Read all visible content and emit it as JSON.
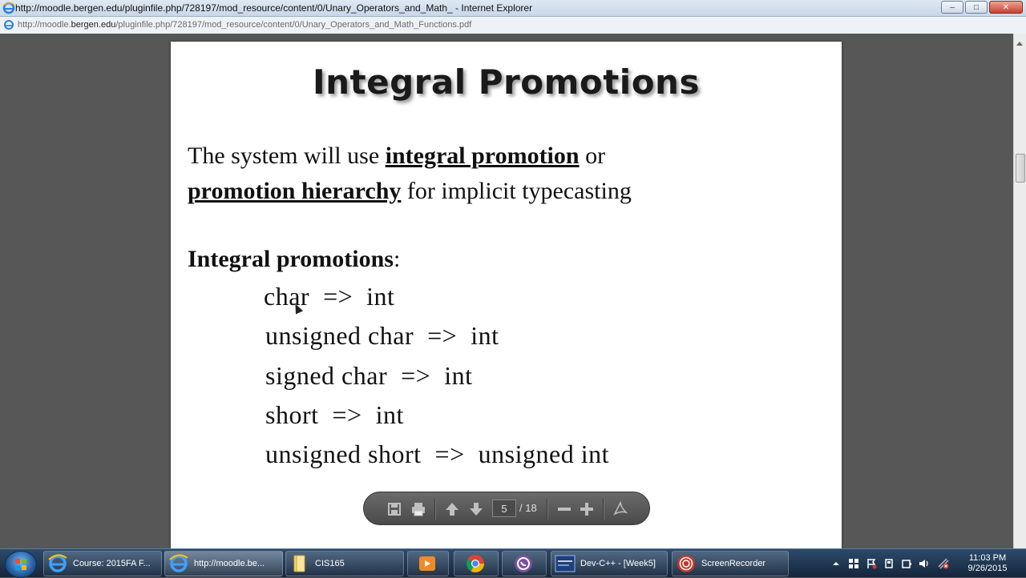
{
  "window": {
    "title": "http://moodle.bergen.edu/pluginfile.php/728197/mod_resource/content/0/Unary_Operators_and_Math_ - Internet Explorer",
    "controls": {
      "minimize": "–",
      "maximize": "□",
      "close": "✕"
    }
  },
  "address": {
    "url_prefix": "http://moodle.",
    "url_domain": "bergen.edu",
    "url_suffix": "/pluginfile.php/728197/mod_resource/content/0/Unary_Operators_and_Math_Functions.pdf"
  },
  "slide": {
    "title": "Integral Promotions",
    "intro_1": "The system will use ",
    "intro_term_1": "integral promotion",
    "intro_2": " or",
    "intro_term_2": "promotion hierarchy",
    "intro_3": " for implicit typecasting",
    "list_heading": "Integral promotions",
    "list_colon": ":",
    "promotions": [
      "char  =>  int",
      "unsigned char  =>  int",
      "signed char  =>  int",
      "short  =>  int",
      "unsigned short  =>  unsigned int"
    ]
  },
  "pdf_toolbar": {
    "current_page": "5",
    "total_pages": "/ 18"
  },
  "taskbar": {
    "items": [
      {
        "label": "Course: 2015FA F...",
        "icon": "ie-icon"
      },
      {
        "label": "http://moodle.be...",
        "icon": "ie-icon"
      },
      {
        "label": "CIS165",
        "icon": "folder-icon"
      },
      {
        "label": "",
        "icon": "media-player-icon"
      },
      {
        "label": "",
        "icon": "chrome-icon"
      },
      {
        "label": "",
        "icon": "viber-icon"
      },
      {
        "label": "Dev-C++ - [Week5]",
        "icon": "devcpp-icon"
      },
      {
        "label": "ScreenRecorder",
        "icon": "screenrecorder-icon"
      }
    ],
    "clock_time": "11:03 PM",
    "clock_date": "9/26/2015"
  },
  "colors": {
    "viewer_bg": "#575757",
    "taskbar": "#1e3552",
    "titlebar": "#d4e0ee"
  }
}
